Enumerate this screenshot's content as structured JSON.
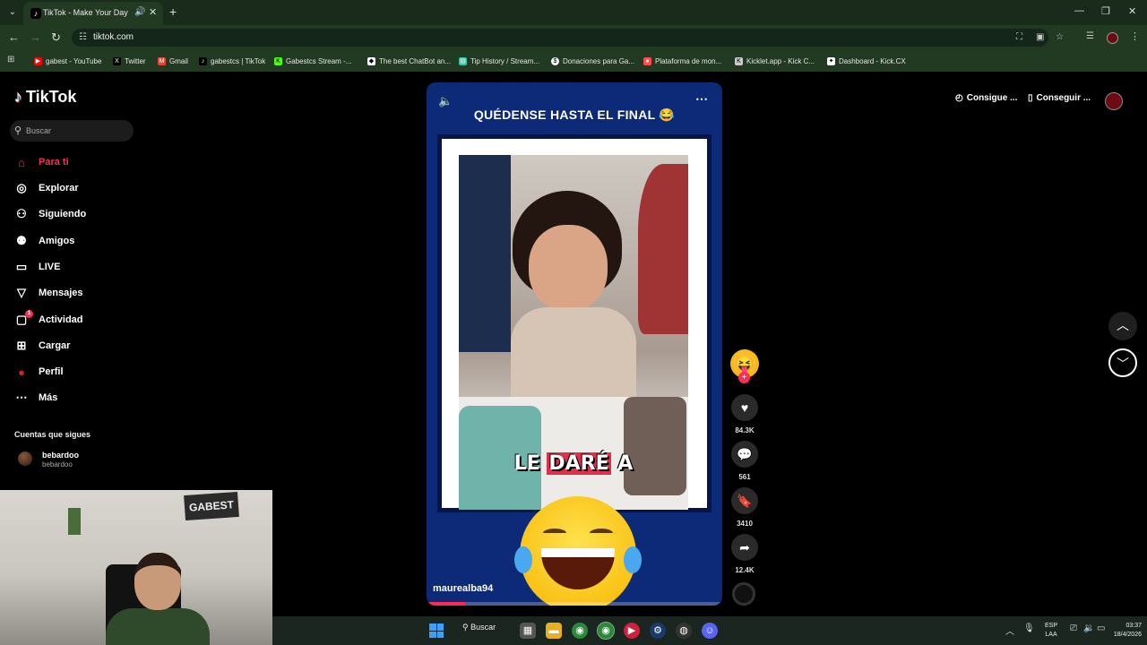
{
  "browser": {
    "tab_title": "TikTok - Make Your Day",
    "url": "tiktok.com",
    "bookmarks": [
      {
        "label": "gabest - YouTube",
        "icon": "youtube-icon",
        "color": "#ff0000"
      },
      {
        "label": "Twitter",
        "icon": "x-icon",
        "color": "#000000"
      },
      {
        "label": "Gmail",
        "icon": "gmail-icon",
        "color": "#ea4335"
      },
      {
        "label": "gabestcs | TikTok",
        "icon": "tiktok-icon",
        "color": "#000000"
      },
      {
        "label": "Gabestcs Stream -...",
        "icon": "kick-icon",
        "color": "#53fc18"
      },
      {
        "label": "The best ChatBot an...",
        "icon": "bot-icon",
        "color": "#ffffff"
      },
      {
        "label": "Tip History / Stream...",
        "icon": "streamlabs-icon",
        "color": "#31c3a2"
      },
      {
        "label": "Donaciones para Ga...",
        "icon": "donation-icon",
        "color": "#ffffff"
      },
      {
        "label": "Plataforma de mon...",
        "icon": "platform-icon",
        "color": "#ff4d4d"
      },
      {
        "label": "Kicklet.app - Kick C...",
        "icon": "kicklet-icon",
        "color": "#cccccc"
      },
      {
        "label": "Dashboard - Kick.CX",
        "icon": "kickcx-icon",
        "color": "#ffffff"
      }
    ]
  },
  "tiktok": {
    "logo_text": "TikTok",
    "search_placeholder": "Buscar",
    "nav": [
      {
        "label": "Para ti",
        "icon": "home-icon",
        "active": true
      },
      {
        "label": "Explorar",
        "icon": "compass-icon",
        "active": false
      },
      {
        "label": "Siguiendo",
        "icon": "following-icon",
        "active": false
      },
      {
        "label": "Amigos",
        "icon": "friends-icon",
        "active": false
      },
      {
        "label": "LIVE",
        "icon": "live-icon",
        "active": false
      },
      {
        "label": "Mensajes",
        "icon": "messages-icon",
        "active": false
      },
      {
        "label": "Actividad",
        "icon": "activity-icon",
        "active": false
      },
      {
        "label": "Cargar",
        "icon": "upload-icon",
        "active": false
      },
      {
        "label": "Perfil",
        "icon": "profile-icon",
        "active": false
      },
      {
        "label": "Más",
        "icon": "more-icon",
        "active": false
      }
    ],
    "activity_badge": "1",
    "following_heading": "Cuentas que sigues",
    "following": [
      {
        "name": "bebardoo",
        "handle": "bebardoo"
      }
    ],
    "promo": [
      {
        "label": "Consigue ...",
        "icon": "coin-icon"
      },
      {
        "label": "Conseguir ...",
        "icon": "phone-icon"
      }
    ],
    "accent_color": "#fe2c55"
  },
  "video": {
    "headline": "QUÉDENSE HASTA EL FINAL 😂",
    "caption_plain": "LE ",
    "caption_mark": "DARÉ",
    "caption_tail": " A",
    "author": "maurealba94",
    "progress": 0.13,
    "creator_avatar_emoji": "😝",
    "actions": [
      {
        "name": "like",
        "icon": "heart-icon",
        "glyph": "♥",
        "count": "84.3K"
      },
      {
        "name": "comment",
        "icon": "comment-icon",
        "glyph": "💬",
        "count": "561"
      },
      {
        "name": "save",
        "icon": "bookmark-icon",
        "glyph": "🔖",
        "count": "3410"
      },
      {
        "name": "share",
        "icon": "share-icon",
        "glyph": "➦",
        "count": "12.4K"
      }
    ]
  },
  "webcam": {
    "sign_text": "GABEST"
  },
  "taskbar": {
    "search_label": "Buscar",
    "lang_line1": "ESP",
    "lang_line2": "LAA",
    "time": "03:37",
    "date": "18/4/2026"
  }
}
